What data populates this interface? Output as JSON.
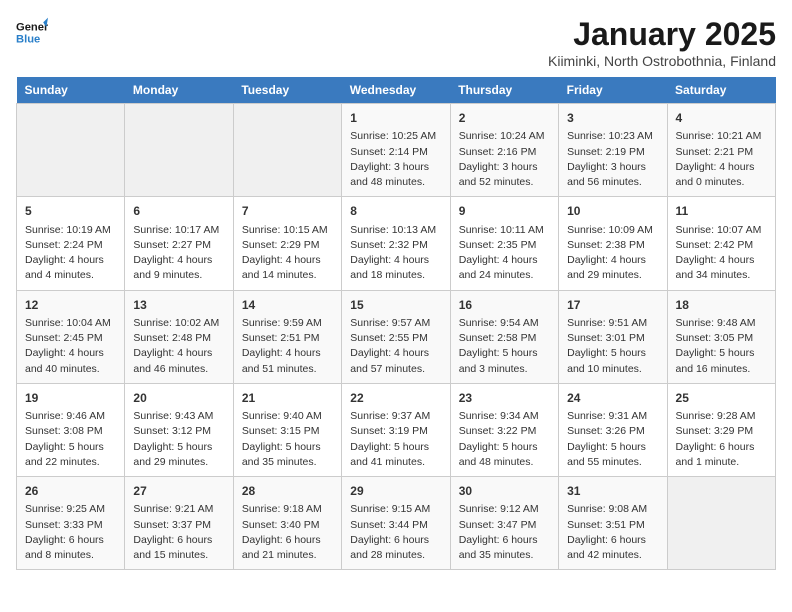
{
  "header": {
    "logo_line1": "General",
    "logo_line2": "Blue",
    "title": "January 2025",
    "subtitle": "Kiiminki, North Ostrobothnia, Finland"
  },
  "weekdays": [
    "Sunday",
    "Monday",
    "Tuesday",
    "Wednesday",
    "Thursday",
    "Friday",
    "Saturday"
  ],
  "weeks": [
    [
      {
        "day": "",
        "info": ""
      },
      {
        "day": "",
        "info": ""
      },
      {
        "day": "",
        "info": ""
      },
      {
        "day": "1",
        "info": "Sunrise: 10:25 AM\nSunset: 2:14 PM\nDaylight: 3 hours and 48 minutes."
      },
      {
        "day": "2",
        "info": "Sunrise: 10:24 AM\nSunset: 2:16 PM\nDaylight: 3 hours and 52 minutes."
      },
      {
        "day": "3",
        "info": "Sunrise: 10:23 AM\nSunset: 2:19 PM\nDaylight: 3 hours and 56 minutes."
      },
      {
        "day": "4",
        "info": "Sunrise: 10:21 AM\nSunset: 2:21 PM\nDaylight: 4 hours and 0 minutes."
      }
    ],
    [
      {
        "day": "5",
        "info": "Sunrise: 10:19 AM\nSunset: 2:24 PM\nDaylight: 4 hours and 4 minutes."
      },
      {
        "day": "6",
        "info": "Sunrise: 10:17 AM\nSunset: 2:27 PM\nDaylight: 4 hours and 9 minutes."
      },
      {
        "day": "7",
        "info": "Sunrise: 10:15 AM\nSunset: 2:29 PM\nDaylight: 4 hours and 14 minutes."
      },
      {
        "day": "8",
        "info": "Sunrise: 10:13 AM\nSunset: 2:32 PM\nDaylight: 4 hours and 18 minutes."
      },
      {
        "day": "9",
        "info": "Sunrise: 10:11 AM\nSunset: 2:35 PM\nDaylight: 4 hours and 24 minutes."
      },
      {
        "day": "10",
        "info": "Sunrise: 10:09 AM\nSunset: 2:38 PM\nDaylight: 4 hours and 29 minutes."
      },
      {
        "day": "11",
        "info": "Sunrise: 10:07 AM\nSunset: 2:42 PM\nDaylight: 4 hours and 34 minutes."
      }
    ],
    [
      {
        "day": "12",
        "info": "Sunrise: 10:04 AM\nSunset: 2:45 PM\nDaylight: 4 hours and 40 minutes."
      },
      {
        "day": "13",
        "info": "Sunrise: 10:02 AM\nSunset: 2:48 PM\nDaylight: 4 hours and 46 minutes."
      },
      {
        "day": "14",
        "info": "Sunrise: 9:59 AM\nSunset: 2:51 PM\nDaylight: 4 hours and 51 minutes."
      },
      {
        "day": "15",
        "info": "Sunrise: 9:57 AM\nSunset: 2:55 PM\nDaylight: 4 hours and 57 minutes."
      },
      {
        "day": "16",
        "info": "Sunrise: 9:54 AM\nSunset: 2:58 PM\nDaylight: 5 hours and 3 minutes."
      },
      {
        "day": "17",
        "info": "Sunrise: 9:51 AM\nSunset: 3:01 PM\nDaylight: 5 hours and 10 minutes."
      },
      {
        "day": "18",
        "info": "Sunrise: 9:48 AM\nSunset: 3:05 PM\nDaylight: 5 hours and 16 minutes."
      }
    ],
    [
      {
        "day": "19",
        "info": "Sunrise: 9:46 AM\nSunset: 3:08 PM\nDaylight: 5 hours and 22 minutes."
      },
      {
        "day": "20",
        "info": "Sunrise: 9:43 AM\nSunset: 3:12 PM\nDaylight: 5 hours and 29 minutes."
      },
      {
        "day": "21",
        "info": "Sunrise: 9:40 AM\nSunset: 3:15 PM\nDaylight: 5 hours and 35 minutes."
      },
      {
        "day": "22",
        "info": "Sunrise: 9:37 AM\nSunset: 3:19 PM\nDaylight: 5 hours and 41 minutes."
      },
      {
        "day": "23",
        "info": "Sunrise: 9:34 AM\nSunset: 3:22 PM\nDaylight: 5 hours and 48 minutes."
      },
      {
        "day": "24",
        "info": "Sunrise: 9:31 AM\nSunset: 3:26 PM\nDaylight: 5 hours and 55 minutes."
      },
      {
        "day": "25",
        "info": "Sunrise: 9:28 AM\nSunset: 3:29 PM\nDaylight: 6 hours and 1 minute."
      }
    ],
    [
      {
        "day": "26",
        "info": "Sunrise: 9:25 AM\nSunset: 3:33 PM\nDaylight: 6 hours and 8 minutes."
      },
      {
        "day": "27",
        "info": "Sunrise: 9:21 AM\nSunset: 3:37 PM\nDaylight: 6 hours and 15 minutes."
      },
      {
        "day": "28",
        "info": "Sunrise: 9:18 AM\nSunset: 3:40 PM\nDaylight: 6 hours and 21 minutes."
      },
      {
        "day": "29",
        "info": "Sunrise: 9:15 AM\nSunset: 3:44 PM\nDaylight: 6 hours and 28 minutes."
      },
      {
        "day": "30",
        "info": "Sunrise: 9:12 AM\nSunset: 3:47 PM\nDaylight: 6 hours and 35 minutes."
      },
      {
        "day": "31",
        "info": "Sunrise: 9:08 AM\nSunset: 3:51 PM\nDaylight: 6 hours and 42 minutes."
      },
      {
        "day": "",
        "info": ""
      }
    ]
  ]
}
